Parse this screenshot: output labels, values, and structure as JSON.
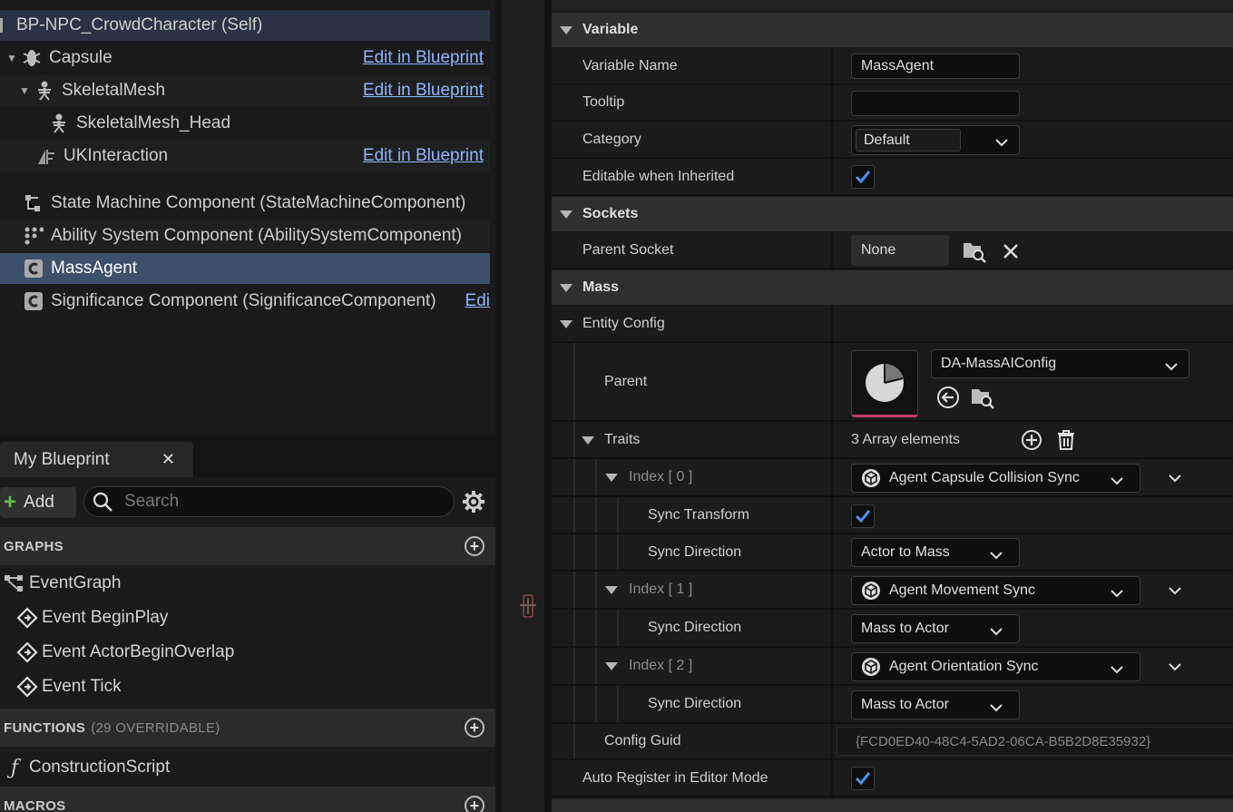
{
  "components": {
    "self_label": "BP-NPC_CrowdCharacter (Self)",
    "edit_label": "Edit in Blueprint",
    "edit_label_truncated": "Edi",
    "items": [
      {
        "label": "Capsule",
        "icon": "capsule-icon"
      },
      {
        "label": "SkeletalMesh",
        "icon": "skeleton-icon"
      },
      {
        "label": "SkeletalMesh_Head",
        "icon": "skeleton-icon"
      },
      {
        "label": "UKInteraction",
        "icon": "interaction-icon"
      },
      {
        "label": "State Machine Component (StateMachineComponent)",
        "icon": "state-machine-icon"
      },
      {
        "label": "Ability System Component (AbilitySystemComponent)",
        "icon": "dots-grid-icon"
      },
      {
        "label": "MassAgent",
        "icon": "cpp-component-icon"
      },
      {
        "label": "Significance Component (SignificanceComponent)",
        "icon": "cpp-component-icon"
      }
    ]
  },
  "my_blueprint": {
    "tab_label": "My Blueprint",
    "add_label": "Add",
    "search_placeholder": "Search",
    "graphs_header": "GRAPHS",
    "graphs": [
      "EventGraph",
      "Event BeginPlay",
      "Event ActorBeginOverlap",
      "Event Tick"
    ],
    "functions_header": "FUNCTIONS",
    "functions_sub": "(29 OVERRIDABLE)",
    "functions": [
      "ConstructionScript"
    ],
    "macros_header": "MACROS"
  },
  "details": {
    "variable": {
      "header": "Variable",
      "name_label": "Variable Name",
      "name_value": "MassAgent",
      "tooltip_label": "Tooltip",
      "tooltip_value": "",
      "category_label": "Category",
      "category_value": "Default",
      "editable_label": "Editable when Inherited",
      "editable_checked": true
    },
    "sockets": {
      "header": "Sockets",
      "parent_socket_label": "Parent Socket",
      "parent_socket_value": "None"
    },
    "mass": {
      "header": "Mass",
      "entity_config_label": "Entity Config",
      "parent_label": "Parent",
      "parent_value": "DA-MassAIConfig",
      "traits_label": "Traits",
      "traits_count": "3 Array elements",
      "traits": [
        {
          "index": "Index [ 0 ]",
          "value": "Agent Capsule Collision Sync",
          "props": [
            {
              "label": "Sync Transform",
              "checkbox": true
            },
            {
              "label": "Sync Direction",
              "value": "Actor to Mass"
            }
          ]
        },
        {
          "index": "Index [ 1 ]",
          "value": "Agent Movement Sync",
          "props": [
            {
              "label": "Sync Direction",
              "value": "Mass to Actor"
            }
          ]
        },
        {
          "index": "Index [ 2 ]",
          "value": "Agent Orientation Sync",
          "props": [
            {
              "label": "Sync Direction",
              "value": "Mass to Actor"
            }
          ]
        }
      ],
      "config_guid_label": "Config Guid",
      "config_guid_value": "{FCD0ED40-48C4-5AD2-06CA-B5B2D8E35932}",
      "auto_register_label": "Auto Register in Editor Mode",
      "auto_register_checked": true
    }
  },
  "colors": {
    "accent": "#4a8fe7",
    "selection": "#3d506b",
    "link": "#8fb6ff",
    "add_green": "#6bbf4a"
  }
}
